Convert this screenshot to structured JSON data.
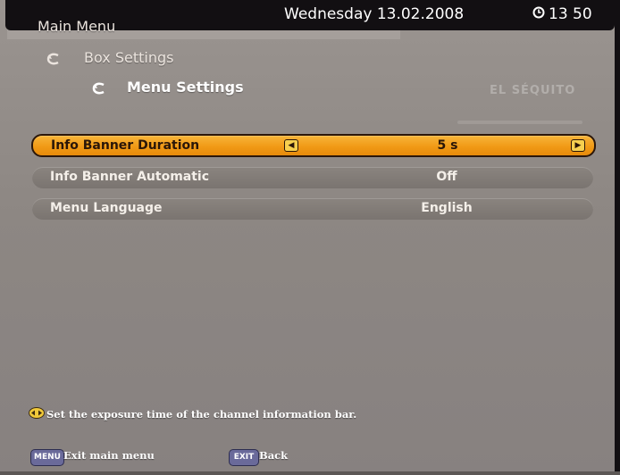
{
  "header": {
    "main_menu": "Main Menu",
    "box_settings": "Box Settings",
    "menu_settings": "Menu Settings",
    "date": "Wednesday 13.02.2008",
    "time": "13 50"
  },
  "watermark": "EL SÉQUITO",
  "settings": [
    {
      "label": "Info Banner Duration",
      "value": "5 s",
      "selected": true
    },
    {
      "label": "Info Banner Automatic",
      "value": "Off",
      "selected": false
    },
    {
      "label": "Menu Language",
      "value": "English",
      "selected": false
    }
  ],
  "help": {
    "text": "Set the exposure time of the channel information bar."
  },
  "footer": {
    "menu_button": "MENU",
    "menu_text": "Exit main menu",
    "exit_button": "EXIT",
    "exit_text": "Back"
  },
  "colors": {
    "selected_row": "#f19a16",
    "row": "#7f7975",
    "background": "#8e8884",
    "frame": "#120f12"
  },
  "icons": {
    "breadcrumb": "curved-arrow-icon",
    "clock": "clock-icon",
    "left_arrow": "left-arrow-icon",
    "right_arrow": "right-arrow-icon",
    "help_nav": "left-right-nav-icon"
  }
}
